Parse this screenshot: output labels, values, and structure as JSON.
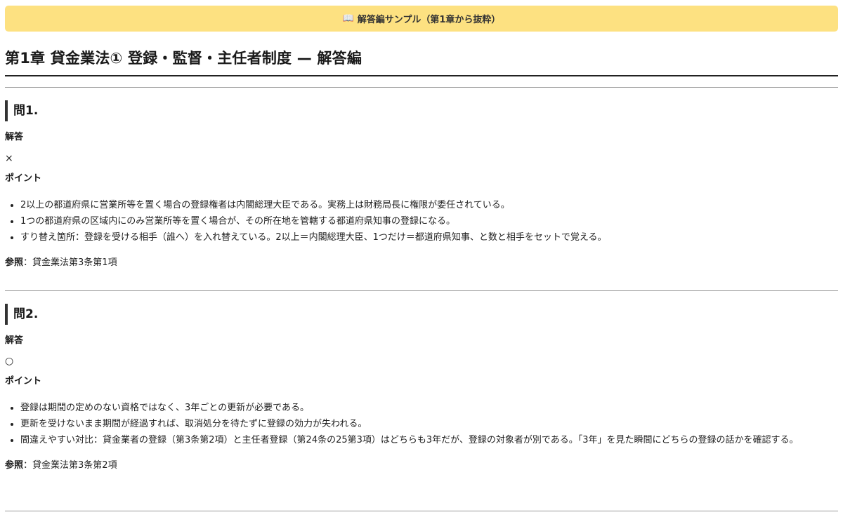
{
  "banner": {
    "icon": "open-book-icon",
    "text": "解答編サンプル（第1章から抜粋）",
    "color": "#fde181"
  },
  "chapter_title": "第1章 貸金業法① 登録・監督・主任者制度 — 解答編",
  "labels": {
    "answer": "解答",
    "point": "ポイント",
    "reference": "参照",
    "reference_sep": "："
  },
  "questions": [
    {
      "heading": "問1.",
      "answer": "×",
      "points": [
        "2以上の都道府県に営業所等を置く場合の登録権者は内閣総理大臣である。実務上は財務局長に権限が委任されている。",
        "1つの都道府県の区域内にのみ営業所等を置く場合が、その所在地を管轄する都道府県知事の登録になる。",
        "すり替え箇所：登録を受ける相手（誰へ）を入れ替えている。2以上＝内閣総理大臣、1つだけ＝都道府県知事、と数と相手をセットで覚える。"
      ],
      "reference": "貸金業法第3条第1項"
    },
    {
      "heading": "問2.",
      "answer": "○",
      "points": [
        "登録は期間の定めのない資格ではなく、3年ごとの更新が必要である。",
        "更新を受けないまま期間が経過すれば、取消処分を待たずに登録の効力が失われる。",
        "間違えやすい対比：貸金業者の登録（第3条第2項）と主任者登録（第24条の25第3項）はどちらも3年だが、登録の対象者が別である。「3年」を見た瞬間にどちらの登録の話かを確認する。"
      ],
      "reference": "貸金業法第3条第2項"
    }
  ]
}
